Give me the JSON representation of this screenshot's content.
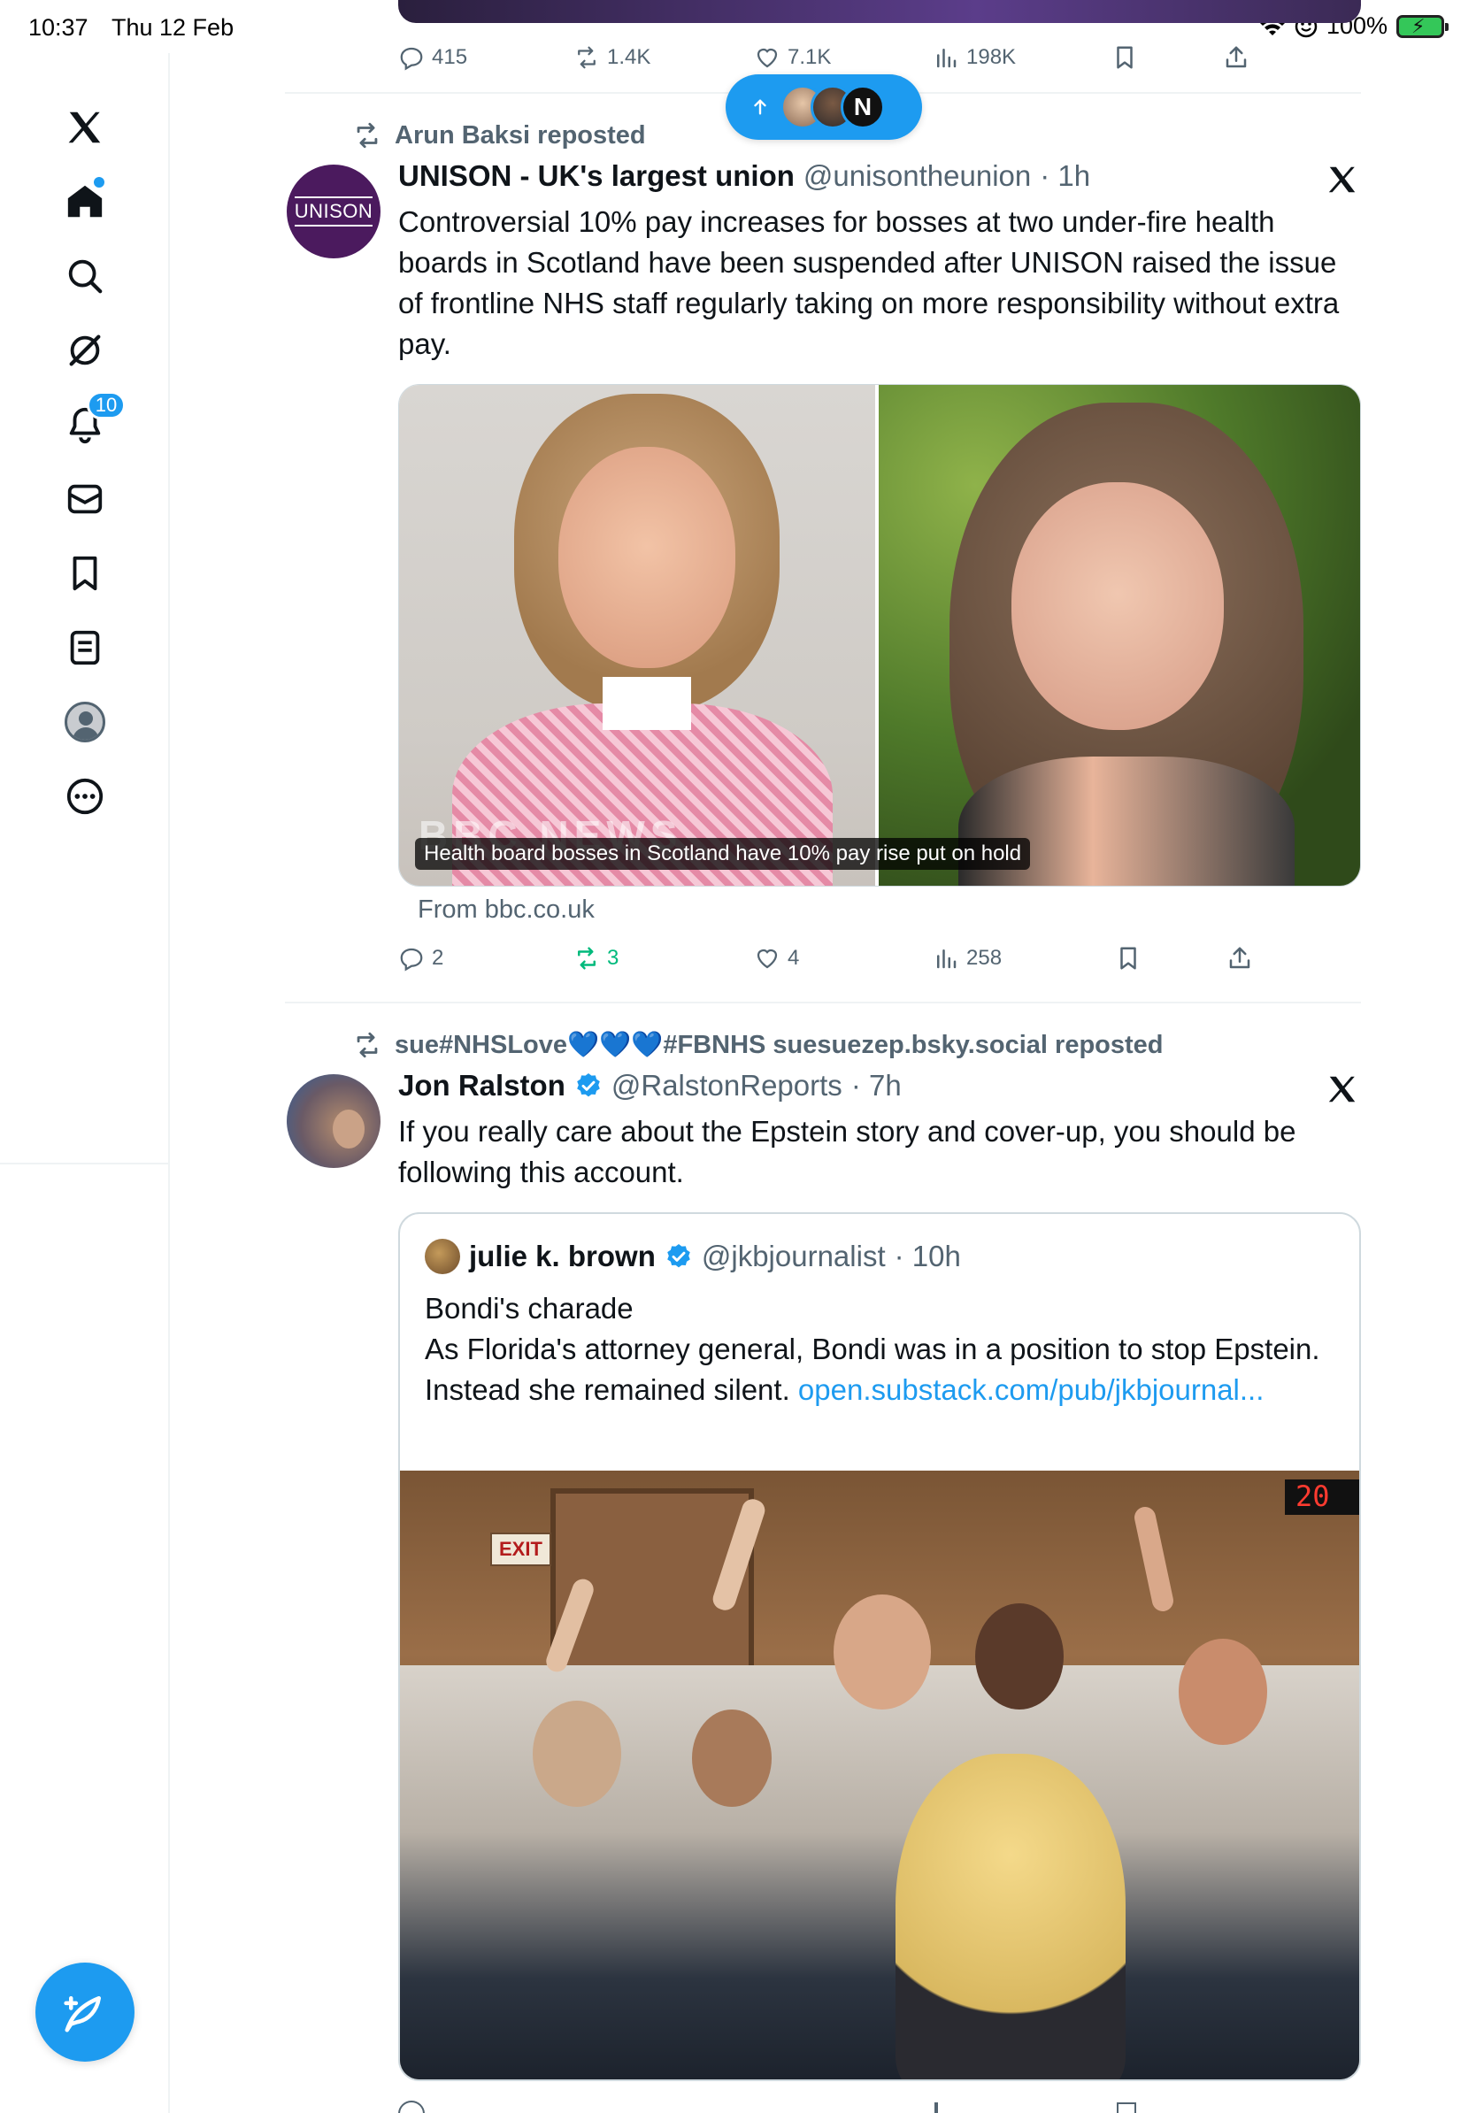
{
  "status_bar": {
    "time": "10:37",
    "date": "Thu 12 Feb",
    "battery": "100%"
  },
  "sidebar": {
    "notifications_badge": "10",
    "items": [
      {
        "name": "x-logo"
      },
      {
        "name": "home"
      },
      {
        "name": "search"
      },
      {
        "name": "grok"
      },
      {
        "name": "notifications"
      },
      {
        "name": "messages"
      },
      {
        "name": "bookmarks"
      },
      {
        "name": "lists"
      },
      {
        "name": "profile"
      },
      {
        "name": "more"
      }
    ]
  },
  "top_actions": {
    "replies": "415",
    "reposts": "1.4K",
    "likes": "7.1K",
    "views": "198K"
  },
  "posts": [
    {
      "reposted_by": "Arun Baksi reposted",
      "author_name": "UNISON - UK's largest union",
      "avatar_text": "UNISON",
      "handle": "@unisontheunion",
      "time": "· 1h",
      "text": "Controversial 10% pay increases for bosses at two under-fire health boards in Scotland have been suspended after UNISON raised the issue of frontline NHS staff regularly taking on more responsibility without extra pay.",
      "media_watermark": "BBC NEWS",
      "media_caption": "Health board bosses in Scotland have 10% pay rise put on hold",
      "source": "From bbc.co.uk",
      "replies": "2",
      "reposts": "3",
      "likes": "4",
      "views": "258"
    },
    {
      "reposted_by": "sue#NHSLove💙💙💙#FBNHS suesuezep.bsky.social reposted",
      "author_name": "Jon Ralston",
      "handle": "@RalstonReports",
      "time": "· 7h",
      "text": "If you really care about the Epstein story and cover-up, you should be following this account.",
      "quote": {
        "author_name": "julie k. brown",
        "handle": "@jkbjournalist",
        "time": "· 10h",
        "line1": "Bondi's charade",
        "line2": "As Florida's attorney general, Bondi was in a position to stop Epstein.",
        "line3": "Instead she remained silent.",
        "link": "open.substack.com/pub/jkbjournal...",
        "media_sign_exit": "EXIT",
        "media_clock": "20"
      }
    }
  ],
  "colors": {
    "accent": "#1d9bf0",
    "repost_green": "#00ba7c",
    "muted": "#536471",
    "unison_purple": "#4b1a5e"
  }
}
